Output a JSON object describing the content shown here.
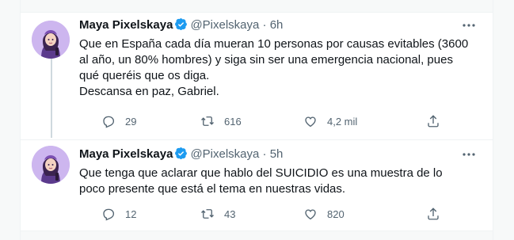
{
  "tweets": [
    {
      "author_name": "Maya Pixelskaya",
      "handle": "@Pixelskaya",
      "separator": "·",
      "time": "6h",
      "text": "Que en España cada día mueran 10 personas por causas evitables (3600\nal año, un 80% hombres) y siga sin ser una emergencia nacional, pues\nqué queréis que os diga.\nDescansa en paz, Gabriel.",
      "replies": "29",
      "retweets": "616",
      "likes": "4,2 mil",
      "avatar_icon": "avatar-illustration",
      "verified_icon": "verified-badge-icon"
    },
    {
      "author_name": "Maya Pixelskaya",
      "handle": "@Pixelskaya",
      "separator": "·",
      "time": "5h",
      "text": "Que tenga que aclarar que hablo del SUICIDIO es una muestra de lo\npoco presente que está el tema en nuestras vidas.",
      "replies": "12",
      "retweets": "43",
      "likes": "820",
      "avatar_icon": "avatar-illustration",
      "verified_icon": "verified-badge-icon"
    }
  ],
  "colors": {
    "background": "#f7f9f9",
    "text_primary": "#0f1419",
    "text_secondary": "#536471",
    "verified": "#1d9bf0",
    "thread_line": "#cfd9de",
    "avatar_bg": "#cdb6ef"
  },
  "icons": [
    "more-icon",
    "reply-icon",
    "retweet-icon",
    "like-icon",
    "share-icon"
  ]
}
